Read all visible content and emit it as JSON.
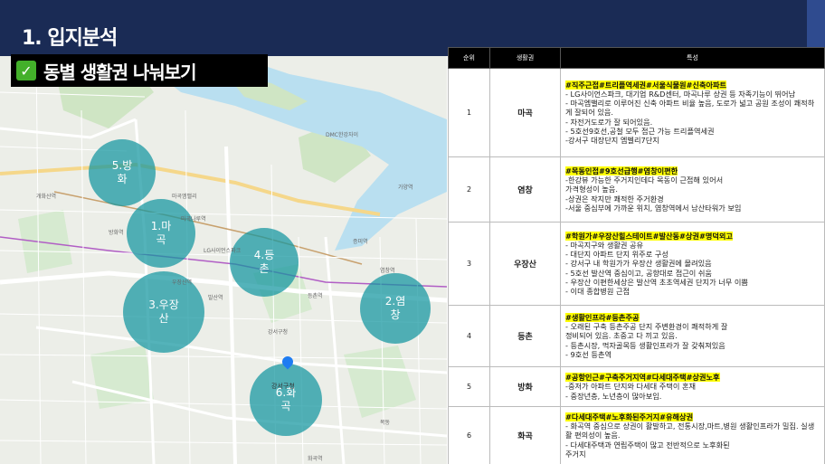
{
  "header": {
    "title": "1. 입지분석",
    "subtitle": "동별 생활권 나눠보기",
    "check_icon": "✅"
  },
  "map": {
    "zones": [
      {
        "label_line1": "5.방",
        "label_line2": "화"
      },
      {
        "label_line1": "1.마",
        "label_line2": "곡"
      },
      {
        "label_line1": "4.등",
        "label_line2": "촌"
      },
      {
        "label_line1": "3.우장",
        "label_line2": "산"
      },
      {
        "label_line1": "2.염",
        "label_line2": "창"
      },
      {
        "label_line1": "6.화",
        "label_line2": "곡"
      }
    ],
    "pin_label": "강서구청",
    "place_labels": [
      "강서IC",
      "DMC한강자이",
      "LG사이언스파크",
      "마곡엠밸리",
      "마곡나루역",
      "우장산역",
      "발산역",
      "화곡역",
      "등촌역",
      "염창역",
      "방화역",
      "개화산역",
      "가양역",
      "증미역",
      "목동",
      "강서구청"
    ]
  },
  "table": {
    "headers": [
      "순위",
      "생활권",
      "특성"
    ],
    "rows": [
      {
        "rank": "1",
        "area": "마곡",
        "tags": "#직주근접#트리플역세권#서울식물원#신축아파트",
        "lines": [
          "- LG사이언스파크, 대기업 R&D센터, 마곡나루 상권 등 자족기능이 뛰어남",
          "-    마곡엠밸리로 이루어진 신축 아파트 비율 높음, 도로가 넓고 공원 조성이 쾌적하게 잘되어 있음.",
          "-    자전거도로가 잘 되어있음.",
          "- 5호선9호선,공철 모두 접근 가능 트리플역세권",
          "-강서구 대장단지 엠벨리7단지"
        ]
      },
      {
        "rank": "2",
        "area": "염창",
        "tags": "#목동인접#9호선급행#염창이편한",
        "lines": [
          "-한강뷰 가능한 주거지인데다 목동이 근접해 있어서",
          "가격형성이 높음.",
          "-상권은 작지만 쾌적한 주거환경",
          "-서울 중심부에 가까운 위치, 염창역에서 남산타워가 보임"
        ]
      },
      {
        "rank": "3",
        "area": "우장산",
        "tags": "#학원가#우장산힐스테이트#발산동#상권#명덕외고",
        "lines": [
          "- 마곡지구와 생활권 공유",
          "- 대단지 아파트 단지 위주로 구성",
          "- 강서구 내 학원가가 우장산 생활권에 몰려있음",
          "- 5호선 발산역 중심이고, 공항대로 접근이 쉬움",
          "- 우장산 이편한세상은 발산역 초초역세권 단지가 너무 이쁨",
          "- 이대 종합병원 근접"
        ]
      },
      {
        "rank": "4",
        "area": "등촌",
        "tags": "#생활인프라#등촌주공",
        "lines": [
          "- 오래된 구축 등촌주공 단지 주변환경이 쾌적하게 잘",
          "정비되어 있음. 초중고 다 끼고 있음.",
          "- 등촌시장, 먹자골목등 생활인프라가 잘 갖춰져있음",
          "- 9호선 등촌역"
        ]
      },
      {
        "rank": "5",
        "area": "방화",
        "tags": "#공항인근#구축주거지역#다세대주택#상권노후",
        "lines": [
          "-중저가 아파트 단지와 다세대 주택이 혼재",
          "- 중장년층, 노년층이 많아보임."
        ]
      },
      {
        "rank": "6",
        "area": "화곡",
        "tags": "#다세대주택#노후화된주거지#유해상권",
        "lines": [
          "- 화곡역 중심으로 상권이 활발하고, 전통시장,마트,병원 생활인프라가 밀집. 실생활 편의성이 높음.",
          "- 다세대주택과 연립주택이 많고 전반적으로 노후화된",
          "주거지"
        ]
      }
    ]
  }
}
